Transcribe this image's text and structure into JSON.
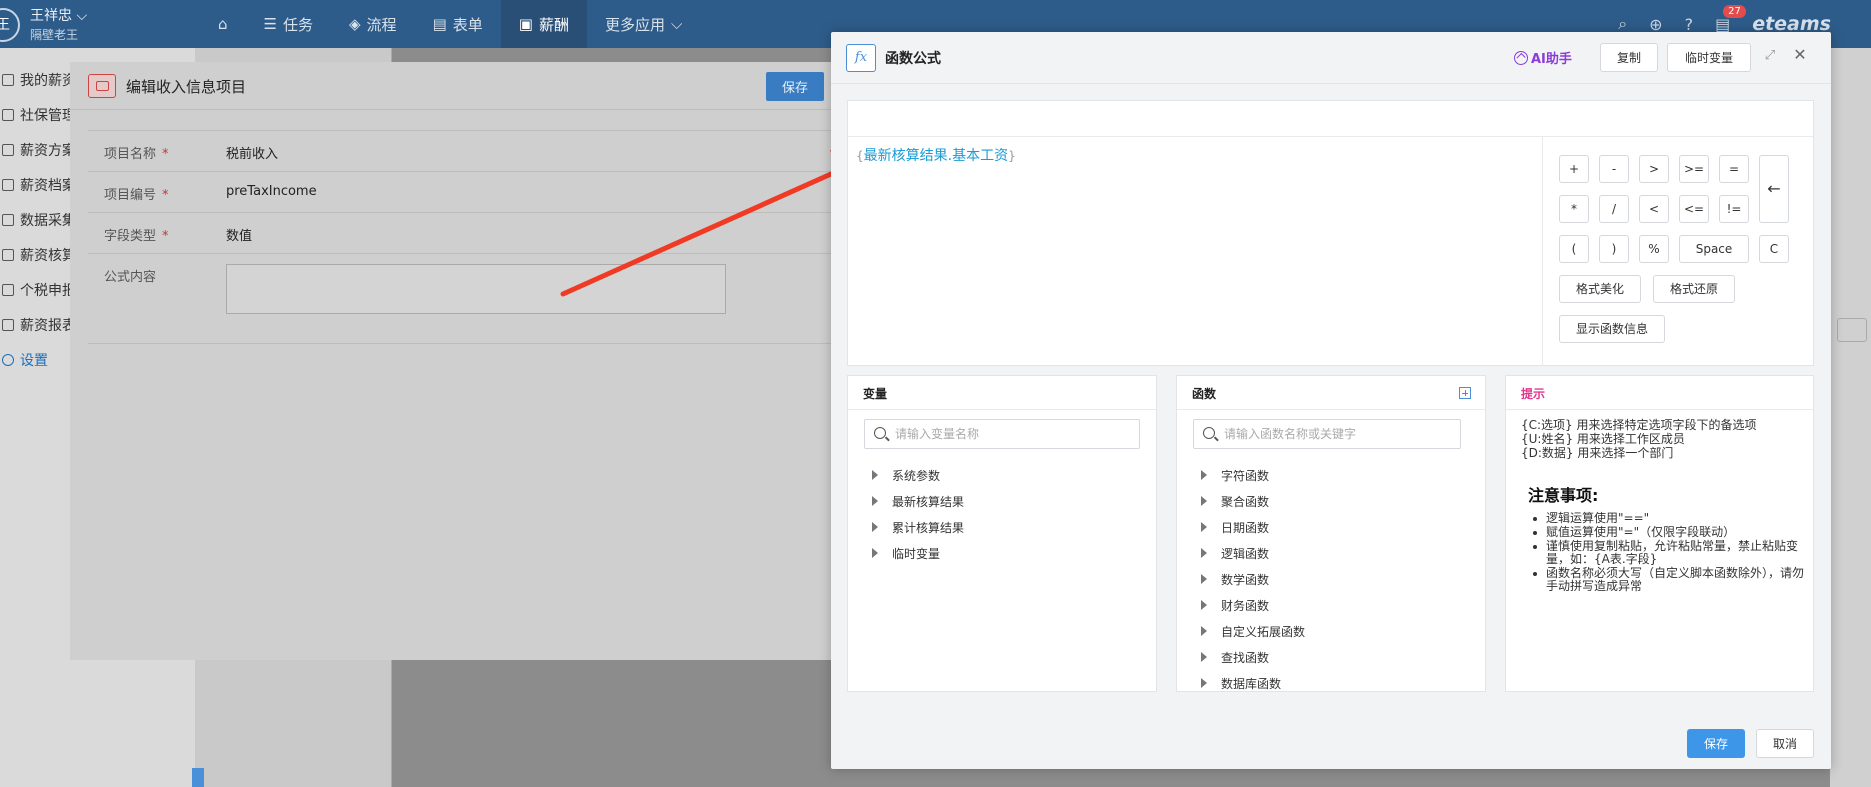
{
  "topbar": {
    "avatar": "王",
    "user_name": "王祥忠",
    "user_sub": "隔壁老王",
    "nav": [
      "任务",
      "流程",
      "表单",
      "薪酬",
      "更多应用"
    ],
    "active_nav": "薪酬",
    "badge": "27",
    "logo": "eteams"
  },
  "sidebar": {
    "items": [
      "我的薪资",
      "社保管理",
      "薪资方案",
      "薪资档案",
      "数据采集",
      "薪资核算",
      "个税申报",
      "薪资报表",
      "设置"
    ]
  },
  "edit_dialog": {
    "title": "编辑收入信息项目",
    "save_label": "保存",
    "fields": [
      {
        "label": "项目名称",
        "value": "税前收入"
      },
      {
        "label": "项目编号",
        "value": "preTaxIncome"
      },
      {
        "label": "字段类型",
        "value": "数值"
      }
    ],
    "formula_label": "公式内容"
  },
  "fx_dialog": {
    "logo": "fx",
    "title": "函数公式",
    "ai_label": "AI助手",
    "copy_label": "复制",
    "temp_var_label": "临时变量",
    "formula": {
      "open": "{",
      "text": "最新核算结果.基本工资",
      "close": "}"
    },
    "keys": {
      "plus": "+",
      "minus": "-",
      "gt": ">",
      "gte": ">=",
      "eq": "=",
      "mul": "*",
      "div": "/",
      "lt": "<",
      "lte": "<=",
      "neq": "!=",
      "lparen": "(",
      "rparen": ")",
      "percent": "%",
      "space": "Space",
      "clear": "C",
      "backspace": "←",
      "beautify": "格式美化",
      "restore": "格式还原",
      "show_info": "显示函数信息"
    },
    "variables": {
      "title": "变量",
      "placeholder": "请输入变量名称",
      "items": [
        "系统参数",
        "最新核算结果",
        "累计核算结果",
        "临时变量"
      ]
    },
    "functions": {
      "title": "函数",
      "placeholder": "请输入函数名称或关键字",
      "items": [
        "字符函数",
        "聚合函数",
        "日期函数",
        "逻辑函数",
        "数学函数",
        "财务函数",
        "自定义拓展函数",
        "查找函数",
        "数据库函数"
      ]
    },
    "hints": {
      "title": "提示",
      "lines": [
        "{C:选项} 用来选择特定选项字段下的备选项",
        "{U:姓名} 用来选择工作区成员",
        "{D:数据} 用来选择一个部门"
      ],
      "notice_title": "注意事项:",
      "notices": [
        "逻辑运算使用\"==\"",
        "赋值运算使用\"=\"（仅限字段联动）",
        "谨慎使用复制粘贴，允许粘贴常量，禁止粘贴变量，如：{A表.字段}",
        "函数名称必须大写（自定义脚本函数除外），请勿手动拼写造成异常"
      ]
    },
    "save_label": "保存",
    "cancel_label": "取消"
  }
}
